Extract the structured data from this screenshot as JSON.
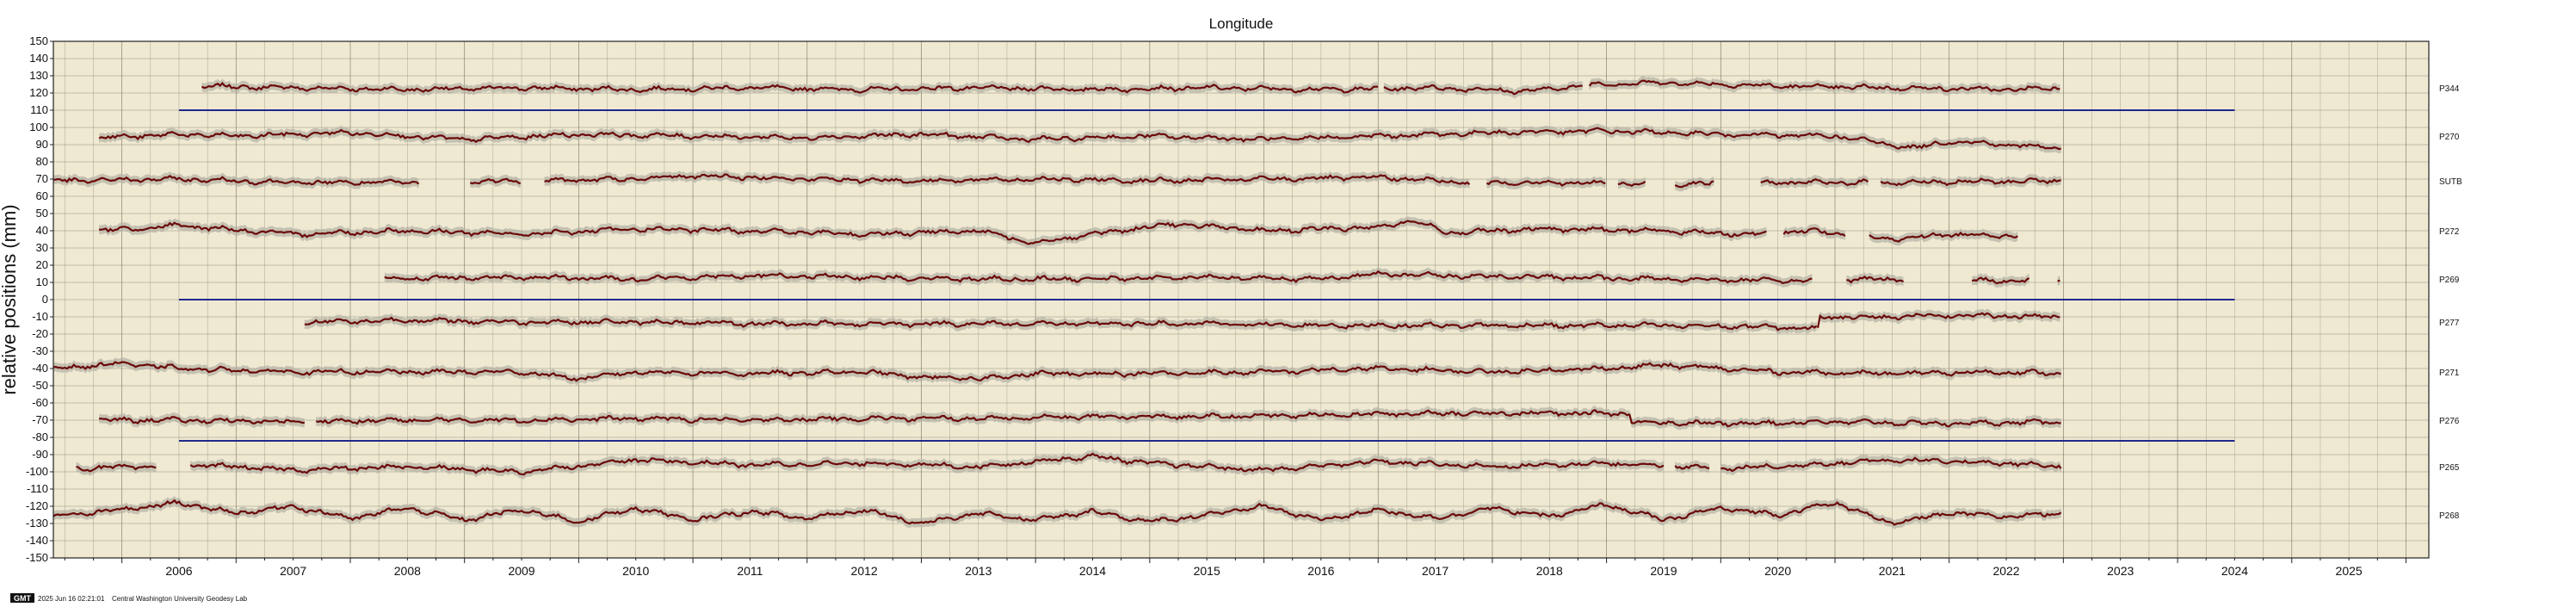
{
  "chart_data": {
    "type": "line",
    "title": "Longitude",
    "ylabel": "relative positions (mm)",
    "xlabel": "",
    "xlim": [
      2005.4,
      2026.2
    ],
    "ylim": [
      -150,
      150
    ],
    "yticks": [
      150,
      140,
      130,
      120,
      110,
      100,
      90,
      80,
      70,
      60,
      50,
      40,
      30,
      20,
      10,
      0,
      -10,
      -20,
      -30,
      -40,
      -50,
      -60,
      -70,
      -80,
      -90,
      -100,
      -110,
      -120,
      -130,
      -140,
      -150
    ],
    "xticks": [
      {
        "label": "2006",
        "value": 2006.0
      },
      {
        "label": "2007",
        "value": 2007.0
      },
      {
        "label": "2008",
        "value": 2008.0
      },
      {
        "label": "2009",
        "value": 2009.0
      },
      {
        "label": "2010",
        "value": 2010.0
      },
      {
        "label": "2011",
        "value": 2011.0
      },
      {
        "label": "2012",
        "value": 2012.0
      },
      {
        "label": "2013",
        "value": 2013.0
      },
      {
        "label": "2014",
        "value": 2014.0
      },
      {
        "label": "2015",
        "value": 2015.0
      },
      {
        "label": "2016",
        "value": 2016.0
      },
      {
        "label": "2017",
        "value": 2017.0
      },
      {
        "label": "2018",
        "value": 2018.0
      },
      {
        "label": "2019",
        "value": 2019.0
      },
      {
        "label": "2020",
        "value": 2020.0
      },
      {
        "label": "2021",
        "value": 2021.0
      },
      {
        "label": "2022",
        "value": 2022.0
      },
      {
        "label": "2023",
        "value": 2023.0
      },
      {
        "label": "2024",
        "value": 2024.0
      },
      {
        "label": "2025",
        "value": 2025.0
      }
    ],
    "grid": true,
    "colors": {
      "background": "#efe9d2",
      "grid": "#6f6a5a",
      "series": "#6b0a0a",
      "band": "#b4b0a4",
      "reference": "#1f2a8a"
    },
    "reference_lines": [
      {
        "y": 110,
        "x_start": 2006.5,
        "x_end": 2024.5
      },
      {
        "y": 0,
        "x_start": 2006.5,
        "x_end": 2024.5
      },
      {
        "y": -82,
        "x_start": 2006.5,
        "x_end": 2024.5
      }
    ],
    "series": [
      {
        "name": "P344",
        "offset": 123,
        "segments": [
          [
            2006.7,
            2017.0
          ],
          [
            2017.05,
            2018.8
          ],
          [
            2018.85,
            2022.98
          ]
        ],
        "points": [
          [
            2006.7,
            124
          ],
          [
            2007.5,
            123
          ],
          [
            2008.5,
            122
          ],
          [
            2009.5,
            123
          ],
          [
            2010.5,
            122
          ],
          [
            2011.5,
            123
          ],
          [
            2012.5,
            122
          ],
          [
            2013.5,
            123
          ],
          [
            2014.5,
            122
          ],
          [
            2015.5,
            123
          ],
          [
            2016.5,
            122
          ],
          [
            2017.5,
            123
          ],
          [
            2018.3,
            121
          ],
          [
            2018.9,
            125
          ],
          [
            2019.5,
            126
          ],
          [
            2020.5,
            124
          ],
          [
            2021.5,
            123
          ],
          [
            2022.5,
            122
          ],
          [
            2022.98,
            123
          ]
        ]
      },
      {
        "name": "P270",
        "offset": 95,
        "segments": [
          [
            2005.8,
            2022.98
          ]
        ],
        "points": [
          [
            2005.8,
            94
          ],
          [
            2006.5,
            96
          ],
          [
            2007.0,
            95
          ],
          [
            2008.0,
            97
          ],
          [
            2009.0,
            93
          ],
          [
            2010.0,
            96
          ],
          [
            2011.0,
            95
          ],
          [
            2012.0,
            94
          ],
          [
            2013.0,
            96
          ],
          [
            2014.0,
            93
          ],
          [
            2015.0,
            95
          ],
          [
            2016.0,
            93
          ],
          [
            2017.0,
            95
          ],
          [
            2018.0,
            97
          ],
          [
            2019.0,
            98
          ],
          [
            2020.0,
            96
          ],
          [
            2021.0,
            95
          ],
          [
            2021.7,
            88
          ],
          [
            2022.0,
            92
          ],
          [
            2022.98,
            88
          ]
        ]
      },
      {
        "name": "SUTB",
        "offset": 69,
        "segments": [
          [
            2005.4,
            2008.6
          ],
          [
            2009.05,
            2009.5
          ],
          [
            2009.7,
            2017.8
          ],
          [
            2017.95,
            2019.0
          ],
          [
            2019.1,
            2019.35
          ],
          [
            2019.6,
            2019.95
          ],
          [
            2020.35,
            2021.3
          ],
          [
            2021.4,
            2022.98
          ]
        ],
        "points": [
          [
            2005.4,
            69
          ],
          [
            2006.5,
            70
          ],
          [
            2007.5,
            68
          ],
          [
            2008.5,
            68
          ],
          [
            2009.5,
            69
          ],
          [
            2010.5,
            70
          ],
          [
            2011.0,
            72
          ],
          [
            2012.0,
            70
          ],
          [
            2013.0,
            69
          ],
          [
            2014.0,
            70
          ],
          [
            2015.0,
            69
          ],
          [
            2016.0,
            70
          ],
          [
            2017.0,
            71
          ],
          [
            2017.8,
            68
          ],
          [
            2018.5,
            68
          ],
          [
            2019.5,
            67
          ],
          [
            2020.5,
            68
          ],
          [
            2021.5,
            68
          ],
          [
            2022.98,
            69
          ]
        ]
      },
      {
        "name": "P272",
        "offset": 40,
        "segments": [
          [
            2005.8,
            2020.4
          ],
          [
            2020.55,
            2021.1
          ],
          [
            2021.3,
            2022.6
          ]
        ],
        "points": [
          [
            2005.8,
            40
          ],
          [
            2006.5,
            43
          ],
          [
            2007.5,
            38
          ],
          [
            2008.5,
            40
          ],
          [
            2009.5,
            38
          ],
          [
            2010.5,
            41
          ],
          [
            2011.5,
            40
          ],
          [
            2012.5,
            38
          ],
          [
            2013.5,
            40
          ],
          [
            2014.0,
            33
          ],
          [
            2014.5,
            38
          ],
          [
            2015.2,
            44
          ],
          [
            2016.0,
            40
          ],
          [
            2017.0,
            42
          ],
          [
            2017.3,
            46
          ],
          [
            2017.6,
            39
          ],
          [
            2018.5,
            41
          ],
          [
            2019.5,
            40
          ],
          [
            2020.2,
            38
          ],
          [
            2020.8,
            40
          ],
          [
            2021.5,
            35
          ],
          [
            2022.0,
            38
          ],
          [
            2022.6,
            37
          ]
        ]
      },
      {
        "name": "P269",
        "offset": 12,
        "segments": [
          [
            2008.3,
            2020.8
          ],
          [
            2021.1,
            2021.6
          ],
          [
            2022.2,
            2022.7
          ],
          [
            2022.95,
            2022.98
          ]
        ],
        "points": [
          [
            2008.3,
            12
          ],
          [
            2009.5,
            13
          ],
          [
            2010.5,
            12
          ],
          [
            2011.5,
            14
          ],
          [
            2012.5,
            13
          ],
          [
            2013.5,
            12
          ],
          [
            2014.5,
            12
          ],
          [
            2015.5,
            13
          ],
          [
            2016.5,
            12
          ],
          [
            2017.0,
            15
          ],
          [
            2017.5,
            14
          ],
          [
            2018.5,
            13
          ],
          [
            2019.5,
            12
          ],
          [
            2020.5,
            11
          ],
          [
            2020.8,
            11
          ],
          [
            2021.3,
            12
          ],
          [
            2022.5,
            11
          ],
          [
            2022.98,
            11
          ]
        ]
      },
      {
        "name": "P277",
        "offset": -13,
        "segments": [
          [
            2007.6,
            2020.85
          ],
          [
            2020.85,
            2022.98
          ]
        ],
        "points": [
          [
            2007.6,
            -13
          ],
          [
            2008.5,
            -12
          ],
          [
            2009.5,
            -13
          ],
          [
            2010.5,
            -13
          ],
          [
            2011.5,
            -14
          ],
          [
            2012.5,
            -14
          ],
          [
            2013.5,
            -14
          ],
          [
            2014.5,
            -14
          ],
          [
            2015.5,
            -14
          ],
          [
            2016.5,
            -15
          ],
          [
            2017.5,
            -15
          ],
          [
            2018.5,
            -15
          ],
          [
            2019.5,
            -15
          ],
          [
            2020.5,
            -16
          ],
          [
            2020.85,
            -17
          ],
          [
            2020.86,
            -10
          ],
          [
            2021.5,
            -10
          ],
          [
            2022.0,
            -9
          ],
          [
            2022.98,
            -10
          ]
        ]
      },
      {
        "name": "P271",
        "offset": -42,
        "segments": [
          [
            2005.4,
            2022.98
          ]
        ],
        "points": [
          [
            2005.4,
            -40
          ],
          [
            2006.0,
            -37
          ],
          [
            2006.5,
            -40
          ],
          [
            2007.5,
            -42
          ],
          [
            2008.5,
            -42
          ],
          [
            2009.5,
            -42
          ],
          [
            2010.0,
            -46
          ],
          [
            2010.5,
            -42
          ],
          [
            2011.5,
            -43
          ],
          [
            2012.5,
            -42
          ],
          [
            2013.0,
            -45
          ],
          [
            2013.5,
            -46
          ],
          [
            2014.0,
            -43
          ],
          [
            2015.0,
            -43
          ],
          [
            2016.0,
            -42
          ],
          [
            2017.0,
            -40
          ],
          [
            2018.0,
            -42
          ],
          [
            2019.0,
            -40
          ],
          [
            2019.5,
            -38
          ],
          [
            2020.5,
            -42
          ],
          [
            2021.5,
            -43
          ],
          [
            2022.5,
            -42
          ],
          [
            2022.98,
            -43
          ]
        ]
      },
      {
        "name": "P276",
        "offset": -70,
        "segments": [
          [
            2005.8,
            2007.6
          ],
          [
            2007.7,
            2019.2
          ],
          [
            2019.2,
            2022.98
          ]
        ],
        "points": [
          [
            2005.8,
            -70
          ],
          [
            2006.5,
            -70
          ],
          [
            2007.5,
            -71
          ],
          [
            2008.5,
            -70
          ],
          [
            2009.5,
            -70
          ],
          [
            2010.5,
            -69
          ],
          [
            2011.5,
            -70
          ],
          [
            2012.5,
            -69
          ],
          [
            2013.5,
            -69
          ],
          [
            2014.5,
            -68
          ],
          [
            2015.5,
            -68
          ],
          [
            2016.5,
            -67
          ],
          [
            2017.5,
            -66
          ],
          [
            2018.5,
            -66
          ],
          [
            2019.2,
            -66
          ],
          [
            2019.21,
            -71
          ],
          [
            2020.0,
            -72
          ],
          [
            2021.0,
            -71
          ],
          [
            2022.0,
            -72
          ],
          [
            2022.98,
            -71
          ]
        ]
      },
      {
        "name": "P265",
        "offset": -97,
        "segments": [
          [
            2005.6,
            2006.3
          ],
          [
            2006.6,
            2019.5
          ],
          [
            2019.6,
            2019.9
          ],
          [
            2020.0,
            2022.98
          ]
        ],
        "points": [
          [
            2005.6,
            -98
          ],
          [
            2006.3,
            -97
          ],
          [
            2006.7,
            -96
          ],
          [
            2007.5,
            -99
          ],
          [
            2008.5,
            -97
          ],
          [
            2009.5,
            -100
          ],
          [
            2010.5,
            -93
          ],
          [
            2011.5,
            -96
          ],
          [
            2012.5,
            -95
          ],
          [
            2013.5,
            -97
          ],
          [
            2014.5,
            -91
          ],
          [
            2015.0,
            -95
          ],
          [
            2016.0,
            -99
          ],
          [
            2017.0,
            -94
          ],
          [
            2018.0,
            -97
          ],
          [
            2019.0,
            -95
          ],
          [
            2020.0,
            -98
          ],
          [
            2020.5,
            -97
          ],
          [
            2021.5,
            -93
          ],
          [
            2022.5,
            -95
          ],
          [
            2022.98,
            -97
          ]
        ]
      },
      {
        "name": "P268",
        "offset": -125,
        "segments": [
          [
            2005.4,
            2022.98
          ]
        ],
        "points": [
          [
            2005.4,
            -126
          ],
          [
            2006.0,
            -122
          ],
          [
            2006.5,
            -118
          ],
          [
            2007.0,
            -124
          ],
          [
            2007.5,
            -120
          ],
          [
            2008.0,
            -127
          ],
          [
            2008.5,
            -121
          ],
          [
            2009.0,
            -128
          ],
          [
            2009.5,
            -122
          ],
          [
            2010.0,
            -129
          ],
          [
            2010.5,
            -121
          ],
          [
            2011.0,
            -128
          ],
          [
            2011.5,
            -123
          ],
          [
            2012.0,
            -127
          ],
          [
            2012.5,
            -122
          ],
          [
            2013.0,
            -130
          ],
          [
            2013.5,
            -124
          ],
          [
            2014.0,
            -128
          ],
          [
            2014.5,
            -123
          ],
          [
            2015.0,
            -129
          ],
          [
            2015.5,
            -125
          ],
          [
            2016.0,
            -120
          ],
          [
            2016.5,
            -128
          ],
          [
            2017.0,
            -122
          ],
          [
            2017.5,
            -127
          ],
          [
            2018.0,
            -121
          ],
          [
            2018.5,
            -126
          ],
          [
            2019.0,
            -119
          ],
          [
            2019.5,
            -128
          ],
          [
            2020.0,
            -121
          ],
          [
            2020.5,
            -125
          ],
          [
            2021.0,
            -118
          ],
          [
            2021.5,
            -130
          ],
          [
            2022.0,
            -124
          ],
          [
            2022.5,
            -126
          ],
          [
            2022.98,
            -124
          ]
        ]
      }
    ]
  },
  "footer": {
    "logo_text": "GMT",
    "timestamp": "2025 Jun 16 02:21:01",
    "credit": "Central Washington University Geodesy Lab"
  }
}
